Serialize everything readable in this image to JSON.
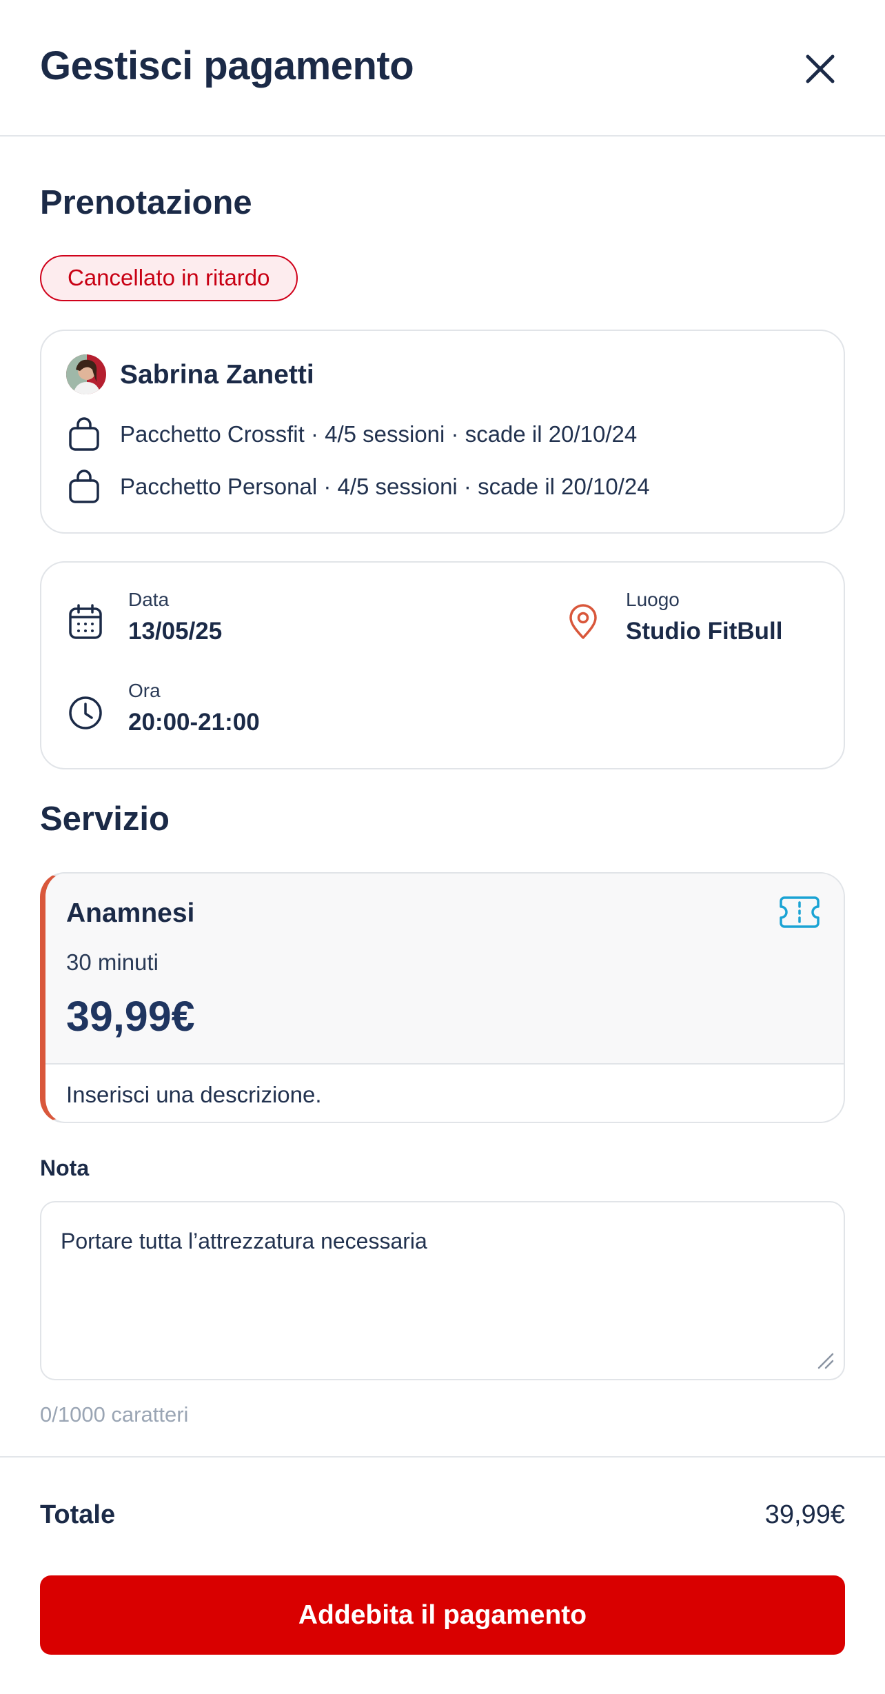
{
  "header": {
    "title": "Gestisci pagamento",
    "close_icon": "close-icon"
  },
  "booking": {
    "section_title": "Prenotazione",
    "status_badge": "Cancellato in ritardo",
    "client": {
      "name": "Sabrina Zanetti",
      "packages": [
        {
          "icon": "shopping-bag-icon",
          "text": "Pacchetto Crossfit · 4/5 sessioni · scade il 20/10/24"
        },
        {
          "icon": "shopping-bag-icon",
          "text": "Pacchetto Personal · 4/5 sessioni · scade il 20/10/24"
        }
      ]
    },
    "details": {
      "date": {
        "icon": "calendar-icon",
        "label": "Data",
        "value": "13/05/25"
      },
      "time": {
        "icon": "clock-icon",
        "label": "Ora",
        "value": "20:00-21:00"
      },
      "location": {
        "icon": "map-pin-icon",
        "label": "Luogo",
        "value": "Studio FitBull"
      }
    }
  },
  "service": {
    "section_title": "Servizio",
    "name": "Anamnesi",
    "duration": "30 minuti",
    "price": "39,99€",
    "description": "Inserisci una descrizione.",
    "icon": "ticket-icon"
  },
  "note": {
    "label": "Nota",
    "value": "Portare tutta l’attrezzatura necessaria",
    "char_count": "0/1000 caratteri"
  },
  "footer": {
    "total_label": "Totale",
    "total_value": "39,99€",
    "pay_button": "Addebita il pagamento"
  },
  "colors": {
    "primary_text": "#1b2a47",
    "danger": "#d90000",
    "badge_bg": "#fdecee",
    "accent_orange": "#d9573b",
    "ticket_blue": "#1aa3d4"
  }
}
